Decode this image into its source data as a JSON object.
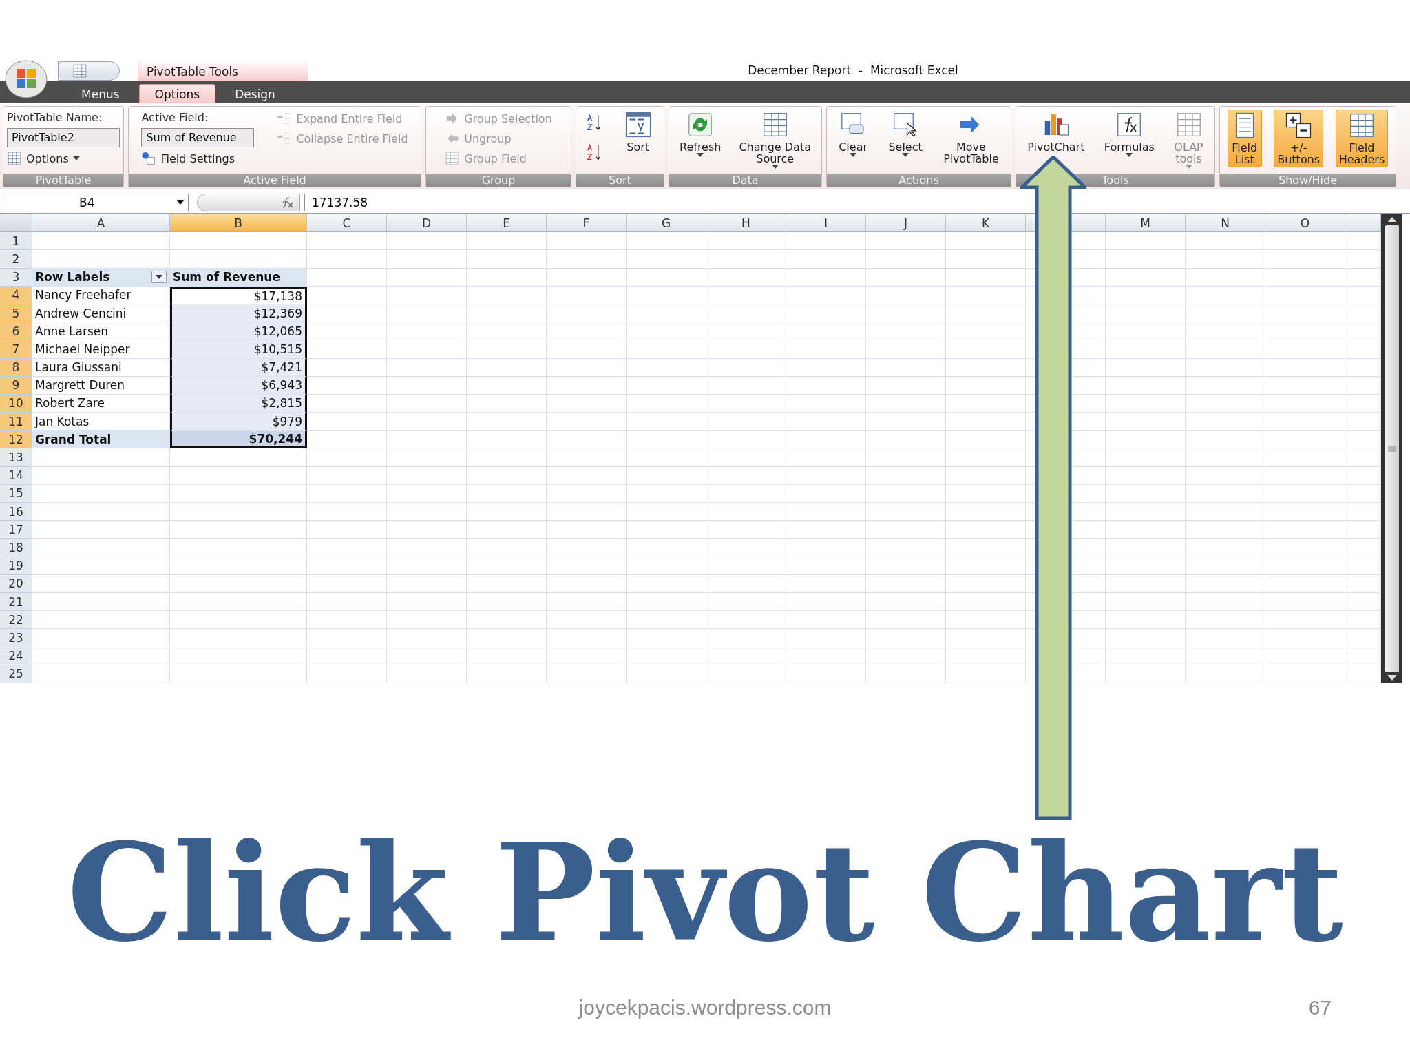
{
  "window": {
    "title": "December Report  -  Microsoft Excel",
    "context_tab": "PivotTable Tools"
  },
  "tabs": [
    {
      "label": "Menus",
      "selected": false
    },
    {
      "label": "Options",
      "selected": true
    },
    {
      "label": "Design",
      "selected": false
    }
  ],
  "ribbon": {
    "groups": [
      {
        "label": "PivotTable",
        "columns": [
          [
            {
              "kind": "caption",
              "label": "PivotTable Name:"
            },
            {
              "kind": "field",
              "value": "PivotTable2"
            },
            {
              "kind": "small",
              "label": "Options",
              "dropdown": true
            }
          ]
        ]
      },
      {
        "label": "Active Field",
        "columns": [
          [
            {
              "kind": "caption",
              "label": "Active Field:"
            },
            {
              "kind": "field",
              "value": "Sum of Revenue"
            },
            {
              "kind": "small",
              "label": "Field Settings"
            }
          ],
          [
            {
              "kind": "small",
              "label": "Expand Entire Field",
              "disabled": true
            },
            {
              "kind": "small",
              "label": "Collapse Entire Field",
              "disabled": true
            }
          ]
        ]
      },
      {
        "label": "Group",
        "columns": [
          [
            {
              "kind": "small",
              "label": "Group Selection",
              "disabled": true
            },
            {
              "kind": "small",
              "label": "Ungroup",
              "disabled": true
            },
            {
              "kind": "small",
              "label": "Group Field",
              "disabled": true
            }
          ]
        ]
      },
      {
        "label": "Sort",
        "columns": [
          [
            {
              "kind": "icon"
            },
            {
              "kind": "icon"
            }
          ],
          [
            {
              "kind": "large",
              "label": "Sort"
            }
          ]
        ]
      },
      {
        "label": "Data",
        "columns": [
          [
            {
              "kind": "large",
              "label": "Refresh",
              "dropdown": true
            }
          ],
          [
            {
              "kind": "large",
              "label": "Change Data\nSource",
              "dropdown": true
            }
          ]
        ]
      },
      {
        "label": "Actions",
        "columns": [
          [
            {
              "kind": "large",
              "label": "Clear",
              "dropdown": true
            }
          ],
          [
            {
              "kind": "large",
              "label": "Select",
              "dropdown": true
            }
          ],
          [
            {
              "kind": "large",
              "label": "Move\nPivotTable"
            }
          ]
        ]
      },
      {
        "label": "Tools",
        "columns": [
          [
            {
              "kind": "large",
              "label": "PivotChart"
            }
          ],
          [
            {
              "kind": "large",
              "label": "Formulas",
              "dropdown": true
            }
          ],
          [
            {
              "kind": "large",
              "label": "OLAP\ntools",
              "dropdown": true,
              "disabled": true
            }
          ]
        ]
      },
      {
        "label": "Show/Hide",
        "columns": [
          [
            {
              "kind": "large",
              "label": "Field\nList",
              "on": true
            }
          ],
          [
            {
              "kind": "large",
              "label": "+/-\nButtons",
              "on": true
            }
          ],
          [
            {
              "kind": "large",
              "label": "Field\nHeaders",
              "on": true
            }
          ]
        ]
      }
    ]
  },
  "formula_bar": {
    "name_box": "B4",
    "value": "17137.58"
  },
  "sheet": {
    "columns": [
      {
        "label": "A",
        "selected": false
      },
      {
        "label": "B",
        "selected": true
      },
      {
        "label": "C",
        "selected": false
      },
      {
        "label": "D",
        "selected": false
      },
      {
        "label": "E",
        "selected": false
      },
      {
        "label": "F",
        "selected": false
      },
      {
        "label": "G",
        "selected": false
      },
      {
        "label": "H",
        "selected": false
      },
      {
        "label": "I",
        "selected": false
      },
      {
        "label": "J",
        "selected": false
      },
      {
        "label": "K",
        "selected": false
      },
      {
        "selected": false
      },
      {
        "label": "M",
        "selected": false
      },
      {
        "label": "N",
        "selected": false
      },
      {
        "label": "O",
        "selected": false
      },
      {
        "selected": false
      }
    ],
    "rows": [
      {
        "number": "1",
        "selected": false
      },
      {
        "number": "2",
        "selected": false
      },
      {
        "number": "3",
        "selected": false,
        "kind": "header",
        "cells": [
          {
            "text": "Row Labels",
            "filter": true
          },
          {
            "text": "Sum of Revenue"
          }
        ]
      },
      {
        "number": "4",
        "selected": true,
        "kind": "item",
        "cells": [
          {
            "text": "Nancy Freehafer",
            "selected": false
          },
          {
            "text": "$17,138",
            "selected": true,
            "active": true
          }
        ]
      },
      {
        "number": "5",
        "selected": true,
        "kind": "item",
        "cells": [
          {
            "text": "Andrew Cencini",
            "selected": false
          },
          {
            "text": "$12,369",
            "selected": true,
            "active": false
          }
        ]
      },
      {
        "number": "6",
        "selected": true,
        "kind": "item",
        "cells": [
          {
            "text": "Anne Larsen",
            "selected": false
          },
          {
            "text": "$12,065",
            "selected": true,
            "active": false
          }
        ]
      },
      {
        "number": "7",
        "selected": true,
        "kind": "item",
        "cells": [
          {
            "text": "Michael Neipper",
            "selected": false
          },
          {
            "text": "$10,515",
            "selected": true,
            "active": false
          }
        ]
      },
      {
        "number": "8",
        "selected": true,
        "kind": "item",
        "cells": [
          {
            "text": "Laura Giussani",
            "selected": false
          },
          {
            "text": "$7,421",
            "selected": true,
            "active": false
          }
        ]
      },
      {
        "number": "9",
        "selected": true,
        "kind": "item",
        "cells": [
          {
            "text": "Margrett Duren",
            "selected": false
          },
          {
            "text": "$6,943",
            "selected": true,
            "active": false
          }
        ]
      },
      {
        "number": "10",
        "selected": true,
        "kind": "item",
        "cells": [
          {
            "text": "Robert Zare",
            "selected": false
          },
          {
            "text": "$2,815",
            "selected": true,
            "active": false
          }
        ]
      },
      {
        "number": "11",
        "selected": true,
        "kind": "item",
        "cells": [
          {
            "text": "Jan Kotas",
            "selected": false
          },
          {
            "text": "$979",
            "selected": true,
            "active": false
          }
        ]
      },
      {
        "number": "12",
        "selected": true,
        "kind": "total",
        "cells": [
          {
            "text": "Grand Total",
            "selected": false
          },
          {
            "text": "$70,244",
            "selected": true,
            "active": false
          }
        ]
      },
      {
        "number": "13",
        "selected": false
      },
      {
        "number": "14",
        "selected": false
      },
      {
        "number": "15",
        "selected": false
      },
      {
        "number": "16",
        "selected": false
      },
      {
        "number": "17",
        "selected": false
      },
      {
        "number": "18",
        "selected": false
      },
      {
        "number": "19",
        "selected": false
      },
      {
        "number": "20",
        "selected": false
      },
      {
        "number": "21",
        "selected": false
      },
      {
        "number": "22",
        "selected": false
      },
      {
        "number": "23",
        "selected": false
      },
      {
        "number": "24",
        "selected": false
      },
      {
        "number": "25",
        "selected": false
      }
    ]
  },
  "slide": {
    "title": "Click Pivot Chart",
    "footer": "joycekpacis.wordpress.com",
    "page_number": "67"
  }
}
